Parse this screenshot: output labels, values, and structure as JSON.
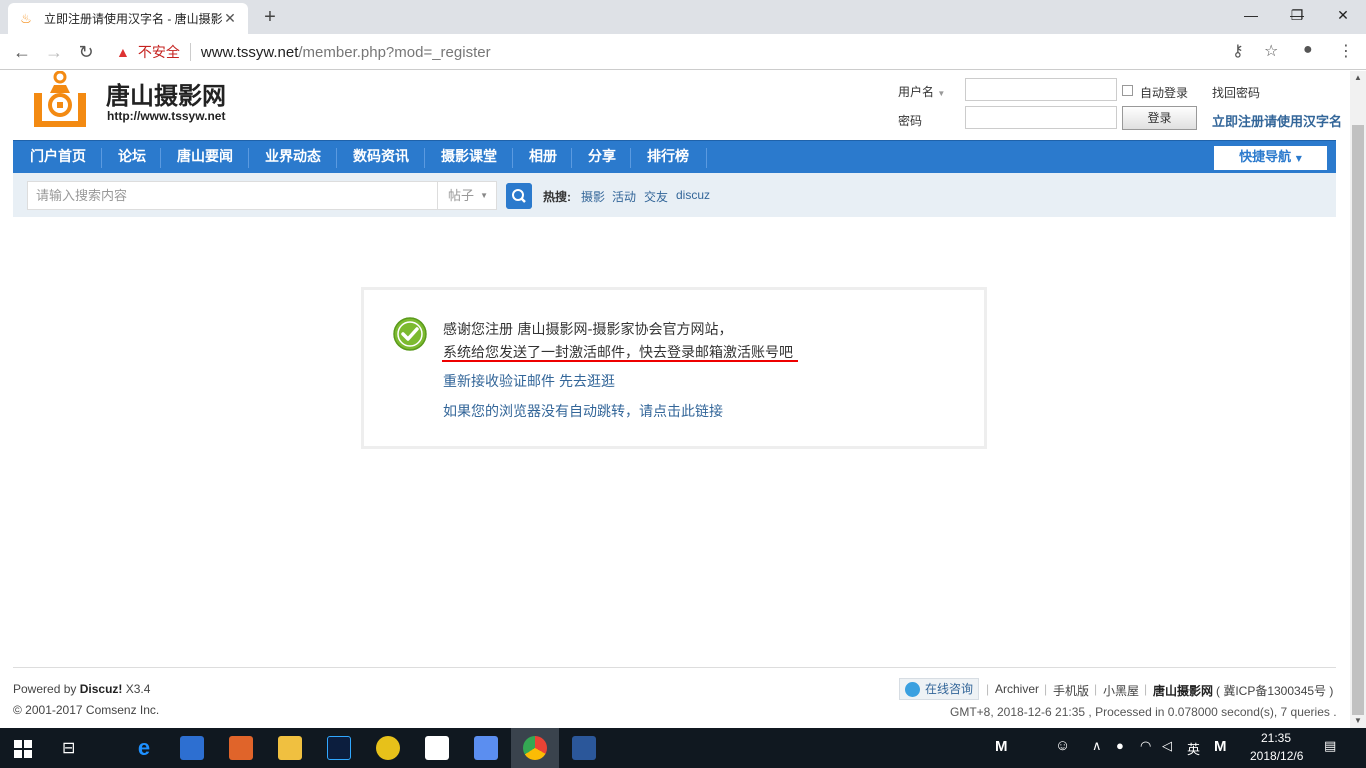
{
  "browser": {
    "tab_title": "立即注册请使用汉字名 - 唐山摄影",
    "tab_close": "✕",
    "new_tab": "+",
    "insecure_label": "不安全",
    "url_host": "www.tssyw.net",
    "url_path": "/member.php?mod=_register",
    "win_minimize": "—",
    "win_restore": "❐",
    "win_close": "✕"
  },
  "site": {
    "name": "唐山摄影网",
    "url": "http://www.tssyw.net"
  },
  "login": {
    "username_label": "用户名",
    "password_label": "密码",
    "auto_login_label": "自动登录",
    "find_password": "找回密码",
    "login_button": "登录",
    "register_link": "立即注册请使用汉字名"
  },
  "nav": {
    "items": [
      {
        "label": "门户首页"
      },
      {
        "label": "论坛"
      },
      {
        "label": "唐山要闻"
      },
      {
        "label": "业界动态"
      },
      {
        "label": "数码资讯"
      },
      {
        "label": "摄影课堂"
      },
      {
        "label": "相册"
      },
      {
        "label": "分享"
      },
      {
        "label": "排行榜"
      }
    ],
    "quick_nav": "快捷导航"
  },
  "search": {
    "placeholder": "请输入搜索内容",
    "type_selected": "帖子",
    "hot_label": "热搜:",
    "hot_items": [
      "摄影",
      "活动",
      "交友",
      "discuz"
    ]
  },
  "message": {
    "line1": "感谢您注册 唐山摄影网-摄影家协会官方网站，",
    "line2": "系统给您发送了一封激活邮件，快去登录邮箱激活账号吧",
    "resend_link": "重新接收验证邮件",
    "browse_link": "先去逛逛",
    "redirect_link": "如果您的浏览器没有自动跳转，请点击此链接"
  },
  "footer": {
    "powered_by": "Powered by",
    "discuz": "Discuz!",
    "version": "X3.4",
    "copyright": "© 2001-2017 Comsenz Inc.",
    "online_consult": "在线咨询",
    "links": [
      "Archiver",
      "手机版",
      "小黑屋"
    ],
    "site_name": "唐山摄影网",
    "icp": "( 冀ICP备1300345号 )",
    "stats": "GMT+8, 2018-12-6 21:35 , Processed in 0.078000 second(s), 7 queries ."
  },
  "taskbar": {
    "time": "21:35",
    "date": "2018/12/6",
    "lang": "英",
    "ime": "M"
  }
}
